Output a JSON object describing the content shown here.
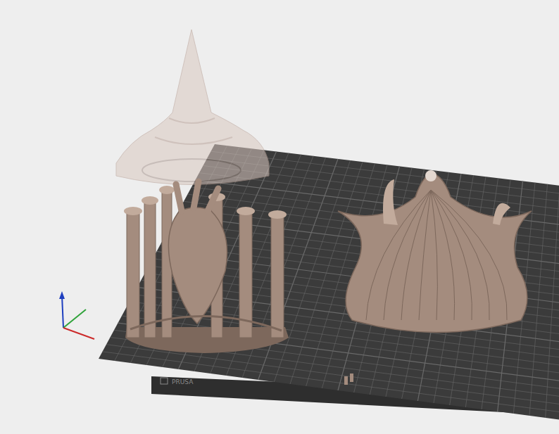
{
  "bed": {
    "label": "PRUSA"
  }
}
